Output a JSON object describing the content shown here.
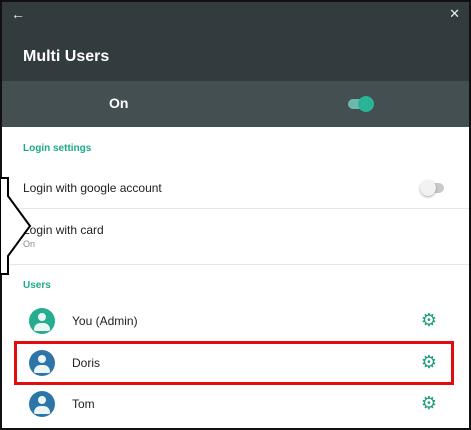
{
  "header": {
    "back_icon": "arrow-left-icon",
    "close_icon": "close-icon",
    "title": "Multi Users"
  },
  "master": {
    "label": "On",
    "enabled": true
  },
  "login_settings": {
    "header": "Login settings",
    "google": {
      "label": "Login with google account",
      "enabled": false
    },
    "card": {
      "label": "Login with card",
      "value": "On"
    }
  },
  "users": {
    "header": "Users",
    "items": [
      {
        "name": "You (Admin)",
        "avatar_color": "#26ad8f",
        "settings_icon": "gear-icon"
      },
      {
        "name": "Doris",
        "avatar_color": "#2d75a8",
        "settings_icon": "gear-icon"
      },
      {
        "name": "Tom",
        "avatar_color": "#2d75a8",
        "settings_icon": "gear-icon"
      }
    ]
  },
  "colors": {
    "topbar": "#323b3d",
    "master_bar": "#434f51",
    "accent": "#1eaa8a",
    "highlight": "#e30b0b"
  }
}
